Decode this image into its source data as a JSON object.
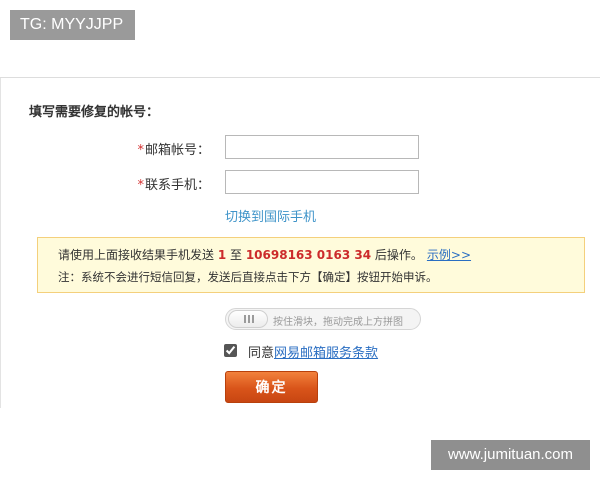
{
  "badge": {
    "text": "TG: MYYJJPP"
  },
  "form": {
    "section_title": "填写需要修复的帐号：",
    "email": {
      "required_mark": "*",
      "label": "邮箱帐号：",
      "value": ""
    },
    "phone": {
      "required_mark": "*",
      "label": "联系手机：",
      "value": ""
    },
    "switch_link": "切换到国际手机"
  },
  "notice": {
    "line1_prefix": "请使用上面接收结果手机发送 ",
    "code": "1",
    "line1_mid": " 至 ",
    "sms_number": "10698163 0163 34",
    "line1_suffix": " 后操作。",
    "example_link": "示例>>",
    "line2": "注：系统不会进行短信回复，发送后直接点击下方【确定】按钮开始申诉。"
  },
  "slider": {
    "hint": "按住滑块，拖动完成上方拼图"
  },
  "agree": {
    "checked": true,
    "prefix": "同意",
    "terms_link": "网易邮箱服务条款"
  },
  "confirm_button": {
    "label": "确定"
  },
  "watermark": {
    "text": "www.jumituan.com"
  },
  "colors": {
    "accent_orange": "#d9541a",
    "link_blue": "#2a6ec2",
    "switch_link_blue": "#3f94c9",
    "highlight_red": "#cc2b2b",
    "notice_bg": "#fffbdb",
    "notice_border": "#f4d07c"
  }
}
